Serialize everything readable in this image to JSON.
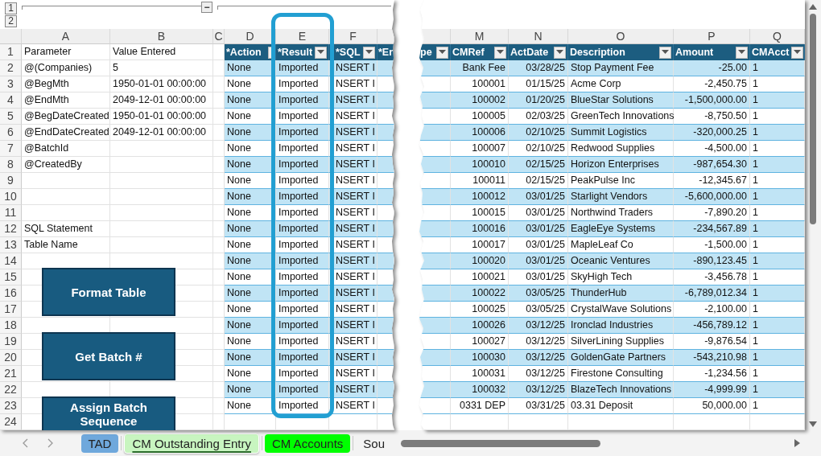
{
  "outline": {
    "levels": [
      "1",
      "2"
    ],
    "collapse_button": "−"
  },
  "left_pane": {
    "column_headers": [
      "A",
      "B",
      "C",
      "D",
      "E",
      "F"
    ],
    "row_headers": [
      "1",
      "2",
      "3",
      "4",
      "5",
      "6",
      "7",
      "8",
      "9",
      "10",
      "11",
      "12",
      "13",
      "14",
      "15",
      "16",
      "17",
      "18",
      "19",
      "20",
      "21",
      "22",
      "23",
      "24"
    ],
    "parameters": [
      {
        "name": "Parameter",
        "value": "Value Entered"
      },
      {
        "name": "@(Companies)",
        "value": "5"
      },
      {
        "name": "@BegMth",
        "value": "1950-01-01 00:00:00"
      },
      {
        "name": "@EndMth",
        "value": "2049-12-01 00:00:00"
      },
      {
        "name": "@BegDateCreated",
        "value": "1950-01-01 00:00:00"
      },
      {
        "name": "@EndDateCreated",
        "value": "2049-12-01 00:00:00"
      },
      {
        "name": "@BatchId"
      },
      {
        "name": "@CreatedBy"
      }
    ],
    "labels": [
      "SQL Statement",
      "Table Name"
    ],
    "table": {
      "headers": [
        "*Action",
        "*Result",
        "*SQL",
        "*Er"
      ],
      "rows": [
        {
          "action": "None",
          "result": "Imported",
          "sql": "NSERT I"
        },
        {
          "action": "None",
          "result": "Imported",
          "sql": "NSERT I"
        },
        {
          "action": "None",
          "result": "Imported",
          "sql": "NSERT I"
        },
        {
          "action": "None",
          "result": "Imported",
          "sql": "NSERT I"
        },
        {
          "action": "None",
          "result": "Imported",
          "sql": "NSERT I"
        },
        {
          "action": "None",
          "result": "Imported",
          "sql": "NSERT I"
        },
        {
          "action": "None",
          "result": "Imported",
          "sql": "NSERT I"
        },
        {
          "action": "None",
          "result": "Imported",
          "sql": "NSERT I"
        },
        {
          "action": "None",
          "result": "Imported",
          "sql": "NSERT I"
        },
        {
          "action": "None",
          "result": "Imported",
          "sql": "NSERT I"
        },
        {
          "action": "None",
          "result": "Imported",
          "sql": "NSERT I"
        },
        {
          "action": "None",
          "result": "Imported",
          "sql": "NSERT I"
        },
        {
          "action": "None",
          "result": "Imported",
          "sql": "NSERT I"
        },
        {
          "action": "None",
          "result": "Imported",
          "sql": "NSERT I"
        },
        {
          "action": "None",
          "result": "Imported",
          "sql": "NSERT I"
        },
        {
          "action": "None",
          "result": "Imported",
          "sql": "NSERT I"
        },
        {
          "action": "None",
          "result": "Imported",
          "sql": "NSERT I"
        },
        {
          "action": "None",
          "result": "Imported",
          "sql": "NSERT I"
        },
        {
          "action": "None",
          "result": "Imported",
          "sql": "NSERT I"
        },
        {
          "action": "None",
          "result": "Imported",
          "sql": "NSERT I"
        },
        {
          "action": "None",
          "result": "Imported",
          "sql": "NSERT I"
        },
        {
          "action": "None",
          "result": "Imported",
          "sql": "NSERT I"
        }
      ]
    },
    "buttons": [
      "Format Table",
      "Get Batch #",
      "Assign Batch Sequence"
    ]
  },
  "right_pane": {
    "column_headers": [
      "M",
      "N",
      "O",
      "P",
      "Q"
    ],
    "table": {
      "headers": [
        "pe",
        "CMRef",
        "ActDate",
        "Description",
        "Amount",
        "CMAcct"
      ],
      "rows": [
        {
          "cmref": "Bank Fee",
          "actdate": "03/28/25",
          "description": "Stop Payment Fee",
          "amount": "-25.00",
          "cmacct": "1"
        },
        {
          "cmref": "100001",
          "actdate": "01/15/25",
          "description": "Acme Corp",
          "amount": "-2,450.75",
          "cmacct": "1"
        },
        {
          "cmref": "100002",
          "actdate": "01/20/25",
          "description": "BlueStar Solutions",
          "amount": "-1,500,000.00",
          "cmacct": "1"
        },
        {
          "cmref": "100005",
          "actdate": "02/03/25",
          "description": "GreenTech Innovations",
          "amount": "-8,750.50",
          "cmacct": "1"
        },
        {
          "cmref": "100006",
          "actdate": "02/10/25",
          "description": "Summit Logistics",
          "amount": "-320,000.25",
          "cmacct": "1"
        },
        {
          "cmref": "100007",
          "actdate": "02/10/25",
          "description": "Redwood Supplies",
          "amount": "-4,500.00",
          "cmacct": "1"
        },
        {
          "cmref": "100010",
          "actdate": "02/15/25",
          "description": "Horizon Enterprises",
          "amount": "-987,654.30",
          "cmacct": "1"
        },
        {
          "cmref": "100011",
          "actdate": "02/15/25",
          "description": "PeakPulse Inc",
          "amount": "-12,345.67",
          "cmacct": "1"
        },
        {
          "cmref": "100012",
          "actdate": "03/01/25",
          "description": "Starlight Vendors",
          "amount": "-5,600,000.00",
          "cmacct": "1"
        },
        {
          "cmref": "100015",
          "actdate": "03/01/25",
          "description": "Northwind Traders",
          "amount": "-7,890.20",
          "cmacct": "1"
        },
        {
          "cmref": "100016",
          "actdate": "03/01/25",
          "description": "EagleEye Systems",
          "amount": "-234,567.89",
          "cmacct": "1"
        },
        {
          "cmref": "100017",
          "actdate": "03/01/25",
          "description": "MapleLeaf Co",
          "amount": "-1,500.00",
          "cmacct": "1"
        },
        {
          "cmref": "100020",
          "actdate": "03/01/25",
          "description": "Oceanic Ventures",
          "amount": "-890,123.45",
          "cmacct": "1"
        },
        {
          "cmref": "100021",
          "actdate": "03/01/25",
          "description": "SkyHigh Tech",
          "amount": "-3,456.78",
          "cmacct": "1"
        },
        {
          "cmref": "100022",
          "actdate": "03/05/25",
          "description": "ThunderHub",
          "amount": "-6,789,012.34",
          "cmacct": "1"
        },
        {
          "cmref": "100025",
          "actdate": "03/05/25",
          "description": "CrystalWave Solutions",
          "amount": "-2,100.00",
          "cmacct": "1"
        },
        {
          "cmref": "100026",
          "actdate": "03/12/25",
          "description": "Ironclad Industries",
          "amount": "-456,789.12",
          "cmacct": "1"
        },
        {
          "cmref": "100027",
          "actdate": "03/12/25",
          "description": "SilverLining Supplies",
          "amount": "-9,876.54",
          "cmacct": "1"
        },
        {
          "cmref": "100030",
          "actdate": "03/12/25",
          "description": "GoldenGate Partners",
          "amount": "-543,210.98",
          "cmacct": "1"
        },
        {
          "cmref": "100031",
          "actdate": "03/12/25",
          "description": "Firestone Consulting",
          "amount": "-1,234.56",
          "cmacct": "1"
        },
        {
          "cmref": "100032",
          "actdate": "03/12/25",
          "description": "BlazeTech Innovations",
          "amount": "-4,999.99",
          "cmacct": "1"
        },
        {
          "cmref": "0331 DEP",
          "actdate": "03/31/25",
          "description": "03.31 Deposit",
          "amount": "50,000.00",
          "cmacct": "1"
        }
      ]
    }
  },
  "sheet_tabs": [
    {
      "label": "TAD",
      "selected": false,
      "color": "#6fa8dc"
    },
    {
      "label": "CM Outstanding Entry",
      "selected": true,
      "color": "#c8f5c0"
    },
    {
      "label": "CM Accounts",
      "selected": false,
      "color": "#00ff00"
    },
    {
      "label": "Sou",
      "selected": false
    }
  ]
}
